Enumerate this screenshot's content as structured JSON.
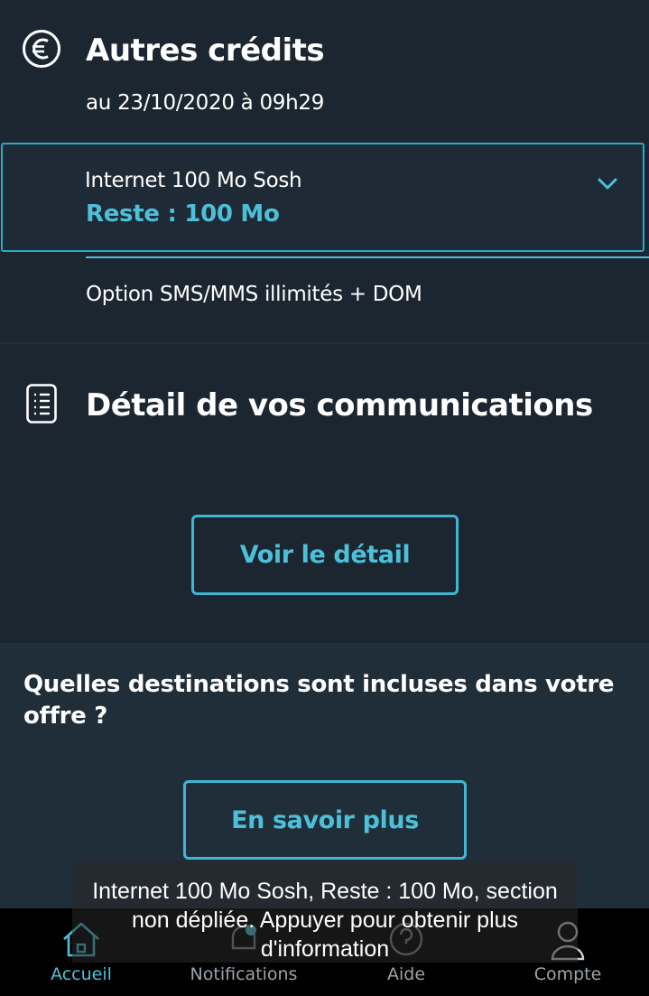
{
  "credits": {
    "title": "Autres crédits",
    "date": "au 23/10/2020 à 09h29",
    "items": [
      {
        "name": "Internet 100 Mo Sosh",
        "remaining": "Reste : 100 Mo"
      },
      {
        "name": "Option SMS/MMS illimités + DOM"
      }
    ]
  },
  "communications": {
    "title": "Détail de vos communications",
    "button_label": "Voir le détail"
  },
  "destinations": {
    "question": "Quelles destinations sont incluses dans votre offre ?",
    "button_label": "En savoir plus"
  },
  "tab_bar": {
    "tabs": [
      {
        "label": "Accueil",
        "icon": "home-icon",
        "active": true
      },
      {
        "label": "Notifications",
        "icon": "bell-icon",
        "active": false
      },
      {
        "label": "Aide",
        "icon": "help-icon",
        "active": false
      },
      {
        "label": "Compte",
        "icon": "user-icon",
        "active": false
      }
    ]
  },
  "toast": {
    "message": "Internet 100 Mo Sosh, Reste : 100 Mo, section non dépliée. Appuyer pour obtenir plus d'information"
  },
  "colors": {
    "background": "#1c2630",
    "accent": "#4cc0d8",
    "border_accent": "#3fb6d3",
    "tab_bar": "#000000"
  }
}
